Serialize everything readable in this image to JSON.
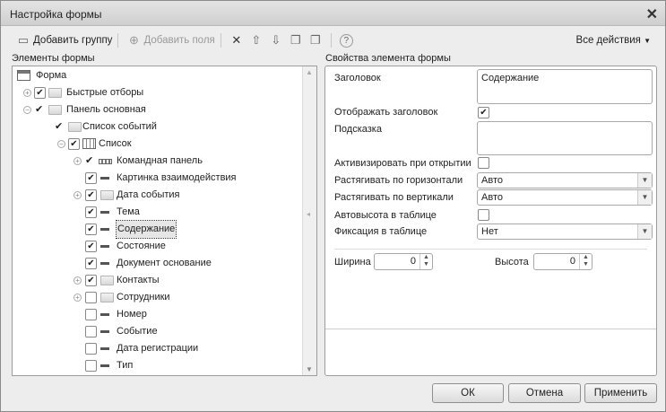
{
  "window": {
    "title": "Настройка формы"
  },
  "toolbar": {
    "add_group": "Добавить группу",
    "add_fields": "Добавить поля",
    "all_actions": "Все действия"
  },
  "tree": {
    "label": "Элементы формы",
    "items": [
      {
        "text": "Форма",
        "level": 0,
        "icon": "form-icon"
      },
      {
        "text": "Быстрые отборы",
        "expander": "+",
        "check": "box-checked",
        "icon": "folder-icon"
      },
      {
        "text": "Панель основная",
        "expander": "-",
        "check": "mark",
        "icon": "folder-icon"
      },
      {
        "text": "Список событий",
        "check": "mark",
        "icon": "folder-icon"
      },
      {
        "text": "Список",
        "expander": "-",
        "check": "box-checked",
        "icon": "table-icon"
      },
      {
        "text": "Командная панель",
        "expander": "+",
        "check": "mark",
        "icon": "command-panel-icon"
      },
      {
        "text": "Картинка взаимодействия",
        "check": "box-checked",
        "icon": "field-icon"
      },
      {
        "text": "Дата события",
        "expander": "+",
        "check": "box-checked",
        "icon": "folder-icon"
      },
      {
        "text": "Тема",
        "check": "box-checked",
        "icon": "field-icon"
      },
      {
        "text": "Содержание",
        "check": "box-checked",
        "icon": "field-icon",
        "selected": true
      },
      {
        "text": "Состояние",
        "check": "box-checked",
        "icon": "field-icon"
      },
      {
        "text": "Документ основание",
        "check": "box-checked",
        "icon": "field-icon"
      },
      {
        "text": "Контакты",
        "expander": "+",
        "check": "box-checked",
        "icon": "folder-icon"
      },
      {
        "text": "Сотрудники",
        "expander": "+",
        "check": "box",
        "icon": "folder-icon"
      },
      {
        "text": "Номер",
        "check": "box",
        "icon": "field-icon"
      },
      {
        "text": "Событие",
        "check": "box",
        "icon": "field-icon"
      },
      {
        "text": "Дата регистрации",
        "check": "box",
        "icon": "field-icon"
      },
      {
        "text": "Тип",
        "check": "box",
        "icon": "field-icon"
      }
    ]
  },
  "props": {
    "label": "Свойства элемента формы",
    "title_label": "Заголовок",
    "title_value": "Содержание",
    "show_title_label": "Отображать заголовок",
    "show_title": true,
    "tooltip_label": "Подсказка",
    "tooltip_value": "",
    "activate_label": "Активизировать при открытии",
    "activate": false,
    "hstretch_label": "Растягивать по горизонтали",
    "hstretch": "Авто",
    "vstretch_label": "Растягивать по вертикали",
    "vstretch": "Авто",
    "autoheight_label": "Автовысота в таблице",
    "autoheight": false,
    "fix_label": "Фиксация в таблице",
    "fix": "Нет",
    "width_label": "Ширина",
    "width": "0",
    "height_label": "Высота",
    "height": "0"
  },
  "buttons": {
    "ok": "ОК",
    "cancel": "Отмена",
    "apply": "Применить"
  }
}
